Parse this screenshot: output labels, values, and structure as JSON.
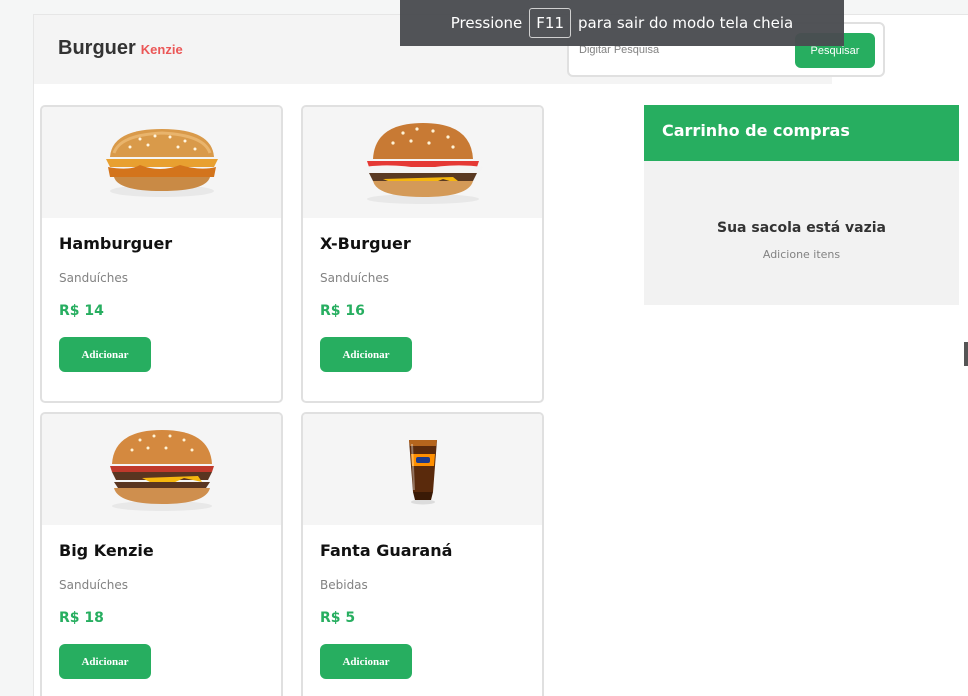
{
  "fullscreen_notice": {
    "before": "Pressione",
    "key": "F11",
    "after": "para sair do modo tela cheia"
  },
  "header": {
    "logo_main": "Burguer",
    "logo_sub": "Kenzie",
    "search_placeholder": "Digitar Pesquisa",
    "search_button": "Pesquisar"
  },
  "products": [
    {
      "name": "Hamburguer",
      "category": "Sanduíches",
      "price": "R$ 14",
      "button": "Adicionar",
      "icon": "hamburger-icon"
    },
    {
      "name": "X-Burguer",
      "category": "Sanduíches",
      "price": "R$ 16",
      "button": "Adicionar",
      "icon": "cheeseburger-icon"
    },
    {
      "name": "Big Kenzie",
      "category": "Sanduíches",
      "price": "R$ 18",
      "button": "Adicionar",
      "icon": "big-burger-icon"
    },
    {
      "name": "Fanta Guaraná",
      "category": "Bebidas",
      "price": "R$ 5",
      "button": "Adicionar",
      "icon": "soda-glass-icon"
    }
  ],
  "cart": {
    "title": "Carrinho de compras",
    "empty_title": "Sua sacola está vazia",
    "empty_subtitle": "Adicione itens"
  },
  "colors": {
    "accent": "#27ae60",
    "brand_red": "#eb5757",
    "text_dark": "#333333",
    "text_muted": "#828282"
  }
}
